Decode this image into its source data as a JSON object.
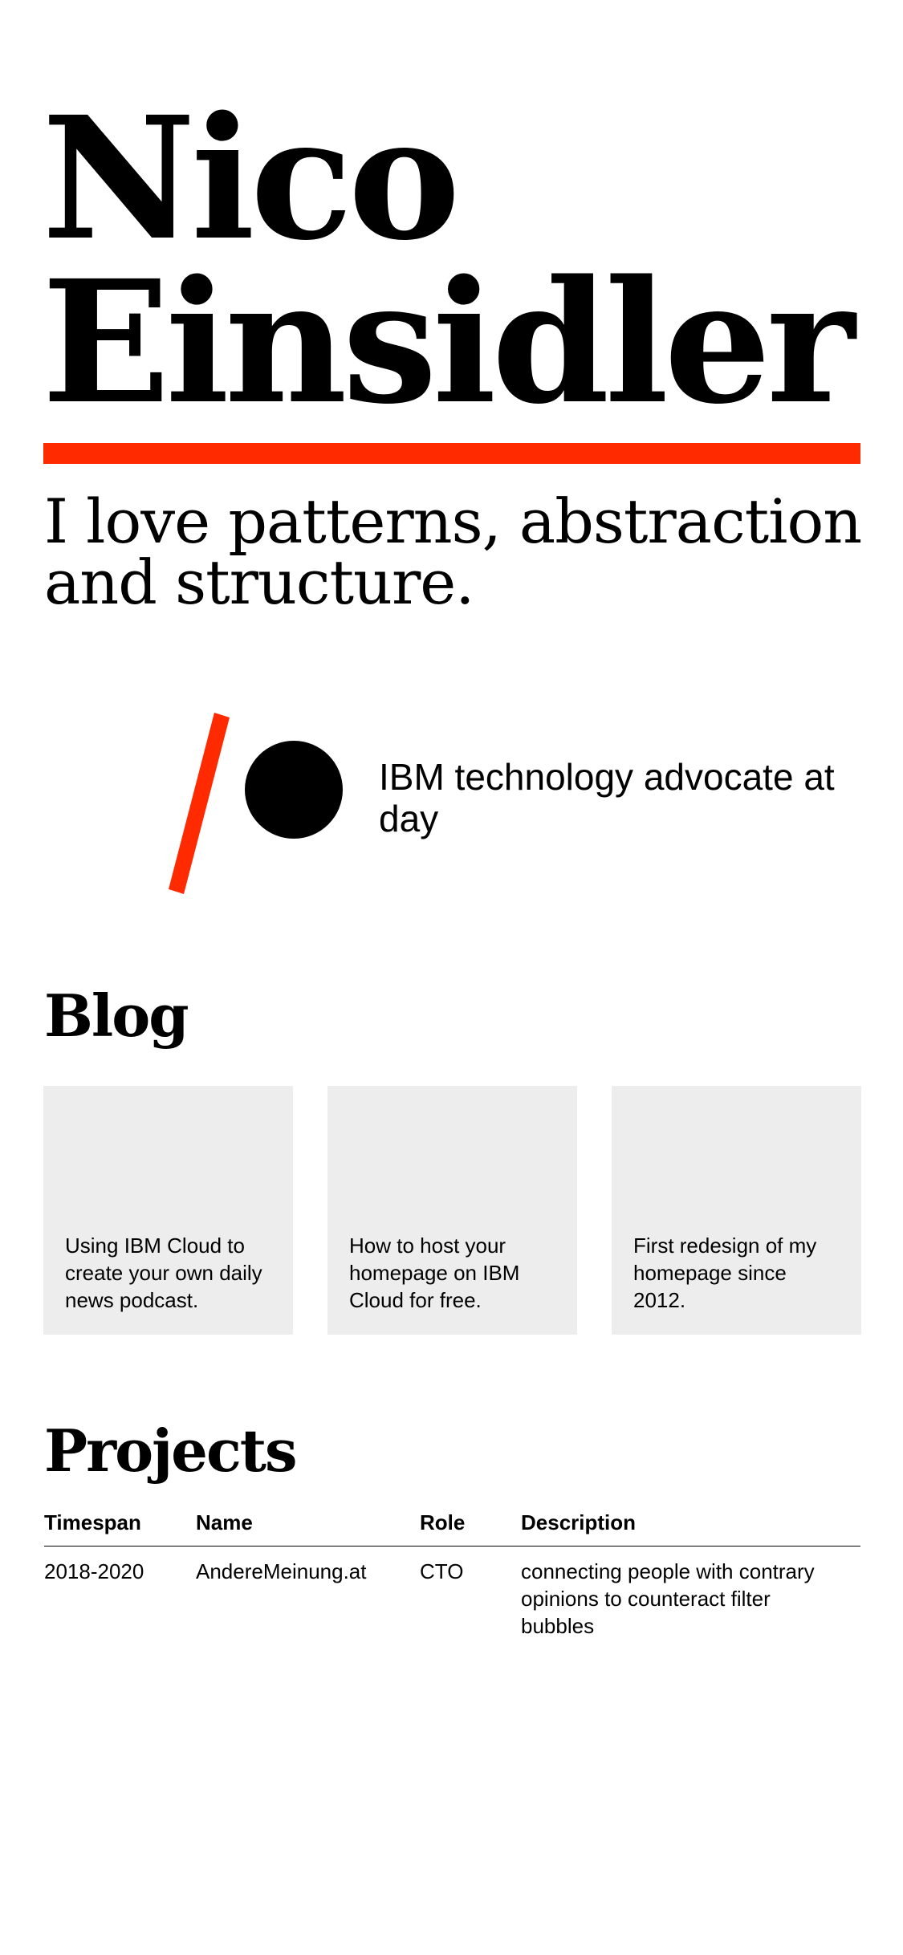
{
  "hero": {
    "first_name": "Nico",
    "last_name": "Einsidler",
    "tagline": "I love patterns, abstraction and structure."
  },
  "logo": {
    "icon": "moon-slash-circle-logo",
    "accent_color": "#ff2a00"
  },
  "advocate_text": "IBM technology advocate at day",
  "blog": {
    "heading": "Blog",
    "posts": [
      {
        "title": "Using IBM Cloud to create your own daily news podcast."
      },
      {
        "title": "How to host your homepage on IBM Cloud for free."
      },
      {
        "title": "First redesign of my homepage since 2012."
      }
    ]
  },
  "projects": {
    "heading": "Projects",
    "columns": [
      "Timespan",
      "Name",
      "Role",
      "Description"
    ],
    "rows": [
      {
        "timespan": "2018-2020",
        "name": "AndereMeinung.at",
        "role": "CTO",
        "description": "connecting people with contrary opinions to counteract filter bubbles"
      }
    ]
  },
  "colors": {
    "accent": "#ff2a00",
    "card_background": "#ededed",
    "text": "#000000",
    "background": "#ffffff"
  }
}
